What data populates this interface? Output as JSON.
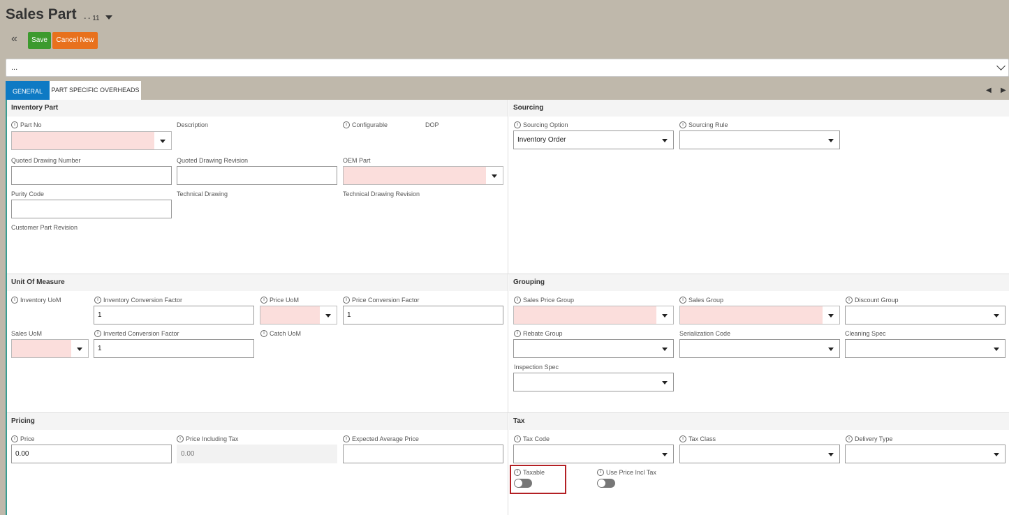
{
  "header": {
    "title": "Sales Part",
    "subtitle": "- - 11",
    "collapse_icon": "«",
    "save_label": "Save",
    "cancel_label": "Cancel New"
  },
  "search": {
    "value": "..."
  },
  "tabs": {
    "general": "GENERAL",
    "overheads": "PART SPECIFIC OVERHEADS",
    "prev_icon": "◀",
    "next_icon": "▶"
  },
  "inventory_part": {
    "title": "Inventory Part",
    "part_no": "Part No",
    "description": "Description",
    "configurable": "Configurable",
    "dop": "DOP",
    "quoted_drawing_number": "Quoted Drawing Number",
    "quoted_drawing_revision": "Quoted Drawing Revision",
    "oem_part": "OEM Part",
    "purity_code": "Purity Code",
    "technical_drawing": "Technical Drawing",
    "technical_drawing_revision": "Technical Drawing Revision",
    "customer_part_revision": "Customer Part Revision"
  },
  "sourcing": {
    "title": "Sourcing",
    "sourcing_option": "Sourcing Option",
    "sourcing_option_value": "Inventory Order",
    "sourcing_rule": "Sourcing Rule"
  },
  "uom": {
    "title": "Unit Of Measure",
    "inventory_uom": "Inventory UoM",
    "inventory_conversion_factor": "Inventory Conversion Factor",
    "inventory_conversion_factor_value": "1",
    "price_uom": "Price UoM",
    "price_conversion_factor": "Price Conversion Factor",
    "price_conversion_factor_value": "1",
    "sales_uom": "Sales UoM",
    "inverted_conversion_factor": "Inverted Conversion Factor",
    "inverted_conversion_factor_value": "1",
    "catch_uom": "Catch UoM"
  },
  "grouping": {
    "title": "Grouping",
    "sales_price_group": "Sales Price Group",
    "sales_group": "Sales Group",
    "discount_group": "Discount Group",
    "rebate_group": "Rebate Group",
    "serialization_code": "Serialization Code",
    "cleaning_spec": "Cleaning Spec",
    "inspection_spec": "Inspection Spec"
  },
  "pricing": {
    "title": "Pricing",
    "price": "Price",
    "price_value": "0.00",
    "price_incl_tax": "Price Including Tax",
    "price_incl_tax_value": "0.00",
    "expected_average_price": "Expected Average Price"
  },
  "tax": {
    "title": "Tax",
    "tax_code": "Tax Code",
    "tax_class": "Tax Class",
    "delivery_type": "Delivery Type",
    "taxable": "Taxable",
    "use_price_incl_tax": "Use Price Incl Tax"
  },
  "info_glyph": "i"
}
